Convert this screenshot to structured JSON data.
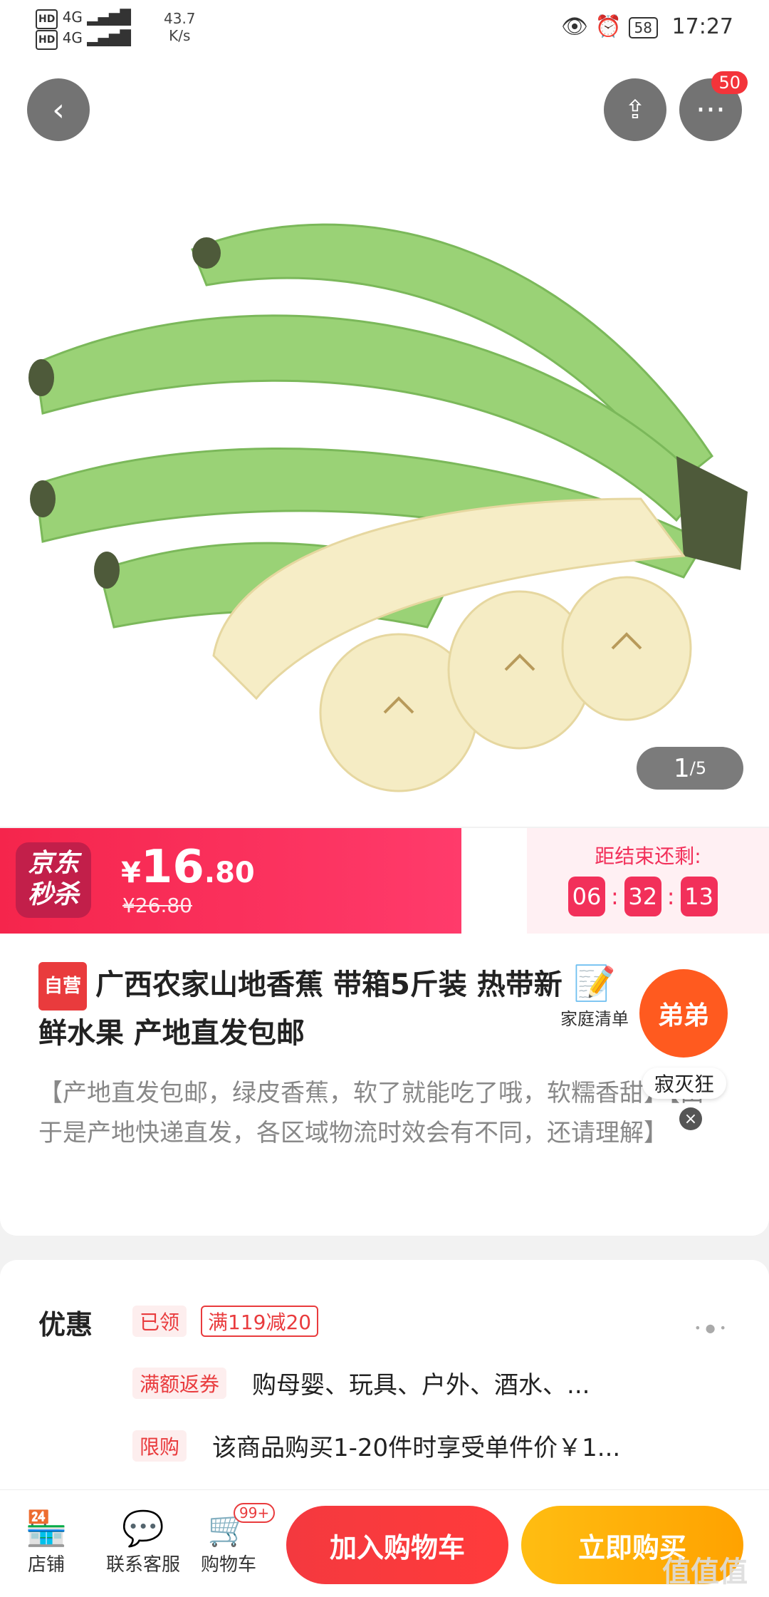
{
  "status_bar": {
    "hd1": "HD",
    "hd2": "HD",
    "net1": "4G",
    "net2": "4G",
    "speed_value": "43.7",
    "speed_unit": "K/s",
    "battery": "58",
    "time": "17:27"
  },
  "hero": {
    "badge_count": "50",
    "pager_current": "1",
    "pager_total": "/5"
  },
  "seckill": {
    "logo_line1": "京东",
    "logo_line2": "秒杀",
    "currency": "¥",
    "price_int": "16",
    "price_dec": ".80",
    "old_price": "¥26.80",
    "end_label": "距结束还剩:",
    "hours": "06",
    "minutes": "32",
    "seconds": "13"
  },
  "product": {
    "tag": "自营",
    "title": "广西农家山地香蕉 带箱5斤装 热带新鲜水果 产地直发包邮",
    "family_list_label": "家庭清单",
    "desc": "【产地直发包邮，绿皮香蕉，软了就能吃了哦，软糯香甜】【由于是产地快递直发，各区域物流时效会有不同，还请理解】"
  },
  "floating": {
    "bubble": "弟弟",
    "name": "寂灭狂",
    "close": "×"
  },
  "promo": {
    "label": "优惠",
    "claimed_tag": "已领",
    "coupon": "满119减20",
    "rebate_tag": "满额返券",
    "rebate_text": "购母婴、玩具、户外、酒水、...",
    "limit_tag": "限购",
    "limit_text": "该商品购买1-20件时享受单件价￥1..."
  },
  "bottom_bar": {
    "store": "店铺",
    "service": "联系客服",
    "cart": "购物车",
    "cart_badge": "99+",
    "add_to_cart": "加入购物车",
    "buy_now": "立即购买",
    "watermark": "值值值"
  },
  "colors": {
    "brand_red": "#e93b3d",
    "seckill_pink": "#f2305a",
    "buy_orange": "#ffa200"
  }
}
